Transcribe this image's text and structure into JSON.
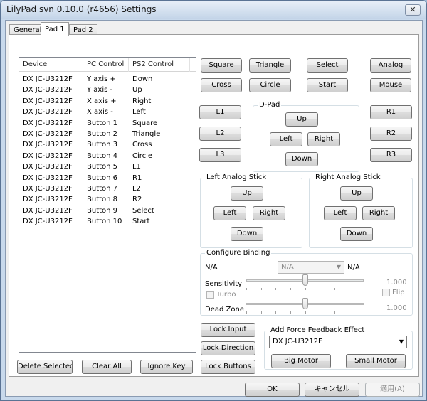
{
  "window": {
    "title": "LilyPad svn 0.10.0 (r4656) Settings",
    "close_glyph": "✕"
  },
  "tabs": [
    {
      "label": "General"
    },
    {
      "label": "Pad 1"
    },
    {
      "label": "Pad 2"
    }
  ],
  "list": {
    "columns": [
      "Device",
      "PC Control",
      "PS2 Control"
    ],
    "rows": [
      {
        "device": "DX JC-U3212F",
        "pc": "Y axis +",
        "ps2": "Down"
      },
      {
        "device": "DX JC-U3212F",
        "pc": "Y axis -",
        "ps2": "Up"
      },
      {
        "device": "DX JC-U3212F",
        "pc": "X axis +",
        "ps2": "Right"
      },
      {
        "device": "DX JC-U3212F",
        "pc": "X axis -",
        "ps2": "Left"
      },
      {
        "device": "DX JC-U3212F",
        "pc": "Button 1",
        "ps2": "Square"
      },
      {
        "device": "DX JC-U3212F",
        "pc": "Button 2",
        "ps2": "Triangle"
      },
      {
        "device": "DX JC-U3212F",
        "pc": "Button 3",
        "ps2": "Cross"
      },
      {
        "device": "DX JC-U3212F",
        "pc": "Button 4",
        "ps2": "Circle"
      },
      {
        "device": "DX JC-U3212F",
        "pc": "Button 5",
        "ps2": "L1"
      },
      {
        "device": "DX JC-U3212F",
        "pc": "Button 6",
        "ps2": "R1"
      },
      {
        "device": "DX JC-U3212F",
        "pc": "Button 7",
        "ps2": "L2"
      },
      {
        "device": "DX JC-U3212F",
        "pc": "Button 8",
        "ps2": "R2"
      },
      {
        "device": "DX JC-U3212F",
        "pc": "Button 9",
        "ps2": "Select"
      },
      {
        "device": "DX JC-U3212F",
        "pc": "Button 10",
        "ps2": "Start"
      }
    ]
  },
  "list_buttons": {
    "delete": "Delete Selected",
    "clear": "Clear All",
    "ignore": "Ignore Key"
  },
  "face_buttons": {
    "square": "Square",
    "triangle": "Triangle",
    "select": "Select",
    "analog": "Analog",
    "cross": "Cross",
    "circle": "Circle",
    "start": "Start",
    "mouse": "Mouse"
  },
  "shoulders": {
    "l1": "L1",
    "l2": "L2",
    "l3": "L3",
    "r1": "R1",
    "r2": "R2",
    "r3": "R3"
  },
  "dpad": {
    "title": "D-Pad",
    "up": "Up",
    "left": "Left",
    "right": "Right",
    "down": "Down"
  },
  "left_stick": {
    "title": "Left Analog Stick",
    "up": "Up",
    "left": "Left",
    "right": "Right",
    "down": "Down"
  },
  "right_stick": {
    "title": "Right Analog Stick",
    "up": "Up",
    "left": "Left",
    "right": "Right",
    "down": "Down"
  },
  "binding": {
    "title": "Configure Binding",
    "left_value": "N/A",
    "combo_value": "N/A",
    "right_value": "N/A",
    "sensitivity_label": "Sensitivity",
    "sensitivity_value": "1.000",
    "sensitivity_level": 0.5,
    "turbo_label": "Turbo",
    "flip_label": "Flip",
    "deadzone_label": "Dead Zone",
    "deadzone_value": "1.000",
    "deadzone_level": 0.5
  },
  "lock_buttons": {
    "input": "Lock Input",
    "direction": "Lock Direction",
    "buttons": "Lock Buttons"
  },
  "force_feedback": {
    "title": "Add Force Feedback Effect",
    "device": "DX JC-U3212F",
    "big_motor": "Big Motor",
    "small_motor": "Small Motor"
  },
  "footer": {
    "ok": "OK",
    "cancel": "キャンセル",
    "apply": "適用(A)"
  }
}
